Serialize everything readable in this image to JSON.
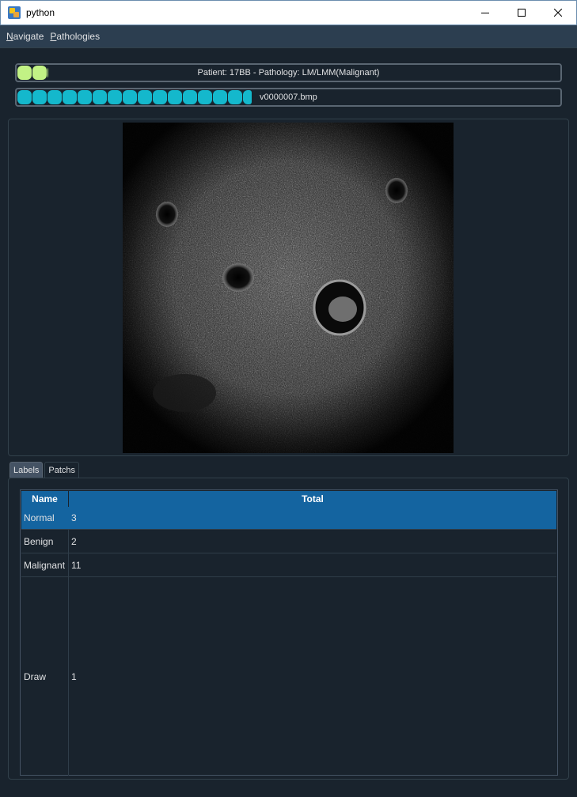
{
  "window": {
    "title": "python",
    "icon": "python-app-icon"
  },
  "menu": {
    "items": [
      {
        "label_underlined": "N",
        "label_rest": "avigate"
      },
      {
        "label_underlined": "P",
        "label_rest": "athologies"
      }
    ]
  },
  "progress": {
    "patient": {
      "text": "Patient: 17BB - Pathology: LM/LMM(Malignant)",
      "color": "#c2f285",
      "fraction": 0.057
    },
    "file": {
      "text": "v0000007.bmp",
      "color": "#14b8cc",
      "fraction": 0.435
    }
  },
  "tabs": [
    {
      "label": "Labels",
      "active": true
    },
    {
      "label": "Patchs",
      "active": false
    }
  ],
  "table": {
    "columns": [
      "Name",
      "Total"
    ],
    "rows": [
      {
        "name": "Normal",
        "total": "3",
        "selected": true
      },
      {
        "name": "Benign",
        "total": "2",
        "selected": false
      },
      {
        "name": "Malignant",
        "total": "11",
        "selected": false
      },
      {
        "name": "Draw",
        "total": "1",
        "selected": false
      }
    ]
  },
  "colors": {
    "background": "#19232d",
    "selection": "#1464a0",
    "menubar": "#2c3e50"
  }
}
